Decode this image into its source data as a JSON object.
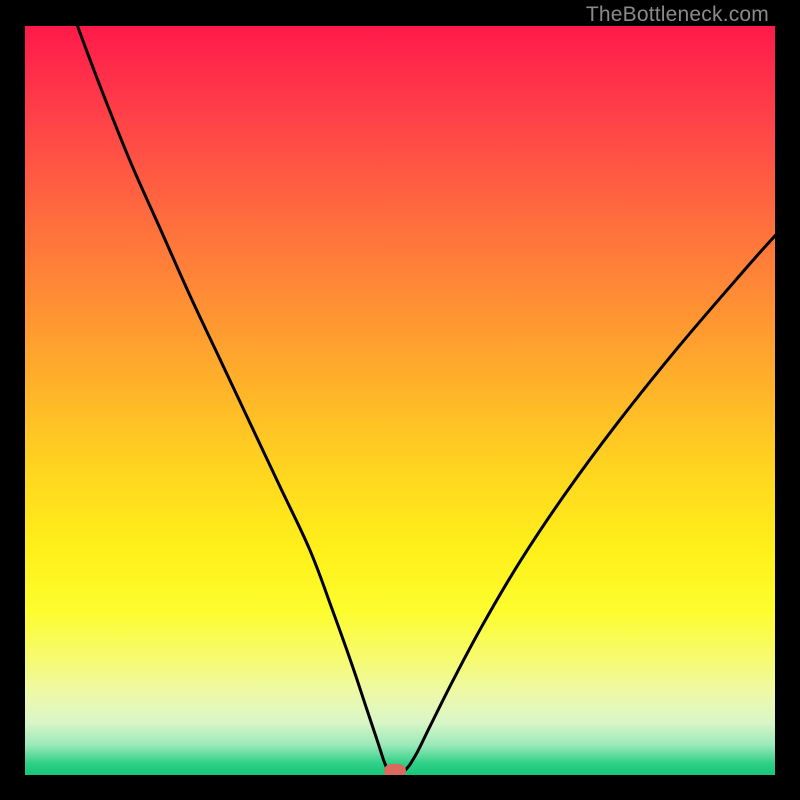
{
  "watermark": "TheBottleneck.com",
  "chart_data": {
    "type": "line",
    "title": "",
    "xlabel": "",
    "ylabel": "",
    "xlim": [
      0,
      100
    ],
    "ylim": [
      0,
      100
    ],
    "grid": false,
    "legend": false,
    "background_gradient": {
      "top": "#ff1a4a",
      "mid": "#ffe41f",
      "bottom": "#17c678"
    },
    "series": [
      {
        "name": "bottleneck-curve",
        "type": "line",
        "color": "#000000",
        "x": [
          7,
          10,
          14,
          18,
          22,
          26,
          30,
          34,
          38,
          41,
          43.5,
          45.5,
          47,
          48,
          48.8,
          50.5,
          52,
          54,
          57,
          61,
          66,
          72,
          79,
          87,
          96,
          100
        ],
        "y": [
          100,
          92,
          82,
          73,
          64,
          55.5,
          47,
          38.5,
          30,
          22,
          15,
          9,
          4.5,
          1.5,
          0.2,
          0.5,
          2.5,
          6.5,
          12.5,
          20,
          28.5,
          37.5,
          47,
          57,
          67.5,
          72
        ]
      }
    ],
    "marker": {
      "name": "optimum-point",
      "x": 49.3,
      "y": 0.6,
      "color": "#d86a60"
    }
  }
}
